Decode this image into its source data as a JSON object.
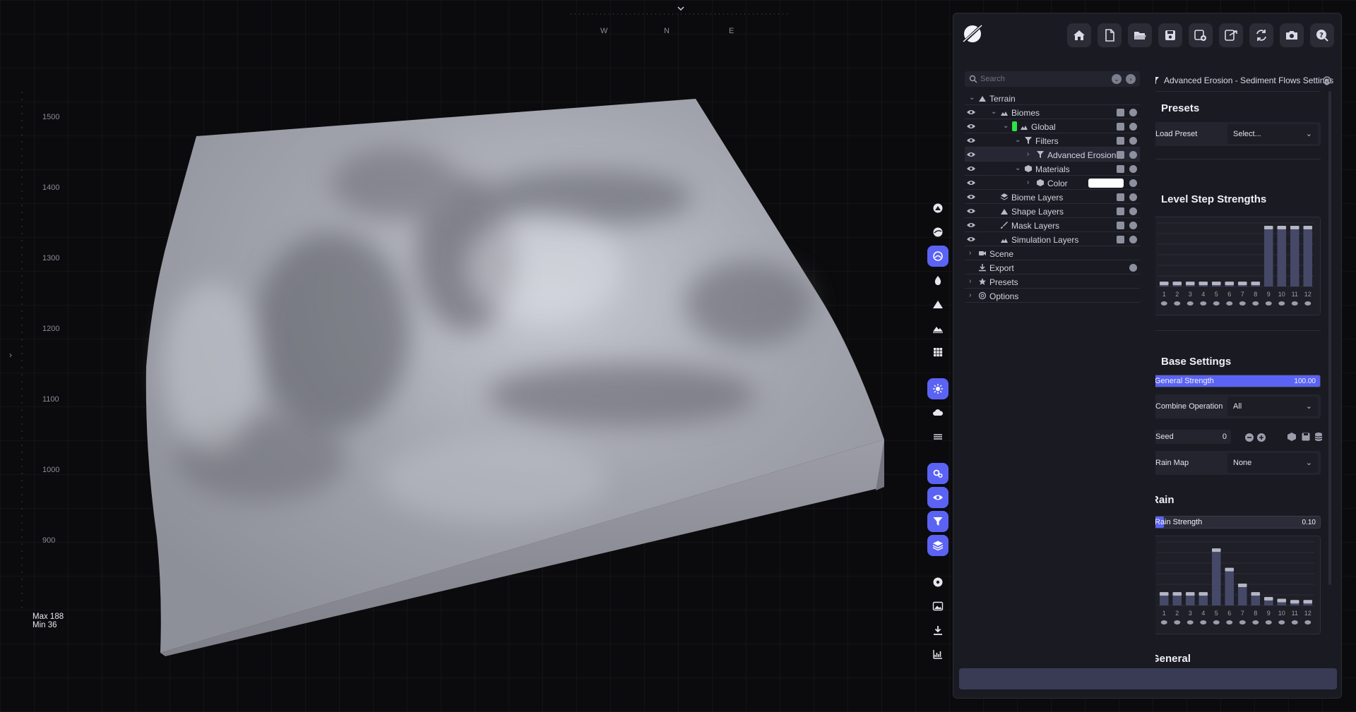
{
  "viewport": {
    "compass": {
      "west": "W",
      "north": "N",
      "east": "E"
    },
    "ruler_labels": [
      "1500",
      "1400",
      "1300",
      "1200",
      "1100",
      "1000",
      "900"
    ],
    "stats": {
      "max": "Max 188",
      "min": "Min 36"
    },
    "colors": {
      "background": "#0b0b0d",
      "grid": "#1e1f24",
      "terrain_top": "#a8aab4",
      "terrain_side": "#8f9099"
    }
  },
  "toolbar": {
    "buttons": [
      {
        "name": "terrain-view-icon",
        "active": false
      },
      {
        "name": "globe-icon",
        "active": false
      },
      {
        "name": "biome-icon",
        "active": true
      },
      {
        "name": "water-drop-icon",
        "active": false
      },
      {
        "name": "mountain-icon",
        "active": false
      },
      {
        "name": "landscape-icon",
        "active": false
      },
      {
        "name": "grid-icon",
        "active": false
      },
      {
        "name": "sun-icon",
        "active": true
      },
      {
        "name": "cloud-icon",
        "active": false
      },
      {
        "name": "fog-icon",
        "active": false
      },
      {
        "name": "settings-gears-icon",
        "active": true
      },
      {
        "name": "eye-icon",
        "active": true
      },
      {
        "name": "filter-icon",
        "active": true
      },
      {
        "name": "layers-icon",
        "active": true
      },
      {
        "name": "target-icon",
        "active": false
      },
      {
        "name": "image-icon",
        "active": false
      },
      {
        "name": "download-icon",
        "active": false
      },
      {
        "name": "chart-icon",
        "active": false
      }
    ]
  },
  "header": {
    "buttons": [
      "home-icon",
      "new-file-icon",
      "open-folder-icon",
      "save-icon",
      "save-as-icon",
      "export-icon",
      "refresh-icon",
      "camera-icon",
      "help-icon"
    ]
  },
  "tree": {
    "search_placeholder": "Search",
    "items": [
      {
        "label": "Terrain",
        "eye": false,
        "indent": 0,
        "icon": "terrain-icon",
        "chev": "open"
      },
      {
        "label": "Biomes",
        "eye": true,
        "indent": 1,
        "icon": "biome-icon",
        "chev": "open",
        "actions": true
      },
      {
        "label": "Global",
        "eye": true,
        "indent": 2,
        "icon": "biome-icon",
        "chev": "open",
        "actions": true,
        "green": true
      },
      {
        "label": "Filters",
        "eye": true,
        "indent": 3,
        "icon": "filter-icon",
        "chev": "open",
        "actions": true
      },
      {
        "label": "Advanced Erosion - Se",
        "eye": true,
        "indent": 4,
        "icon": "filter-icon",
        "chev": "closed",
        "actions": true,
        "selected": true
      },
      {
        "label": "Materials",
        "eye": true,
        "indent": 3,
        "icon": "material-icon",
        "chev": "open",
        "actions": true
      },
      {
        "label": "Color",
        "eye": true,
        "indent": 4,
        "icon": "material-icon",
        "chev": "closed",
        "actions": true,
        "swatch": "#ffffff"
      },
      {
        "label": "Biome Layers",
        "eye": true,
        "indent": 1,
        "icon": "layers-icon",
        "chev": "none",
        "actions": true
      },
      {
        "label": "Shape Layers",
        "eye": true,
        "indent": 1,
        "icon": "mountain-icon",
        "chev": "none",
        "actions": true
      },
      {
        "label": "Mask Layers",
        "eye": true,
        "indent": 1,
        "icon": "brush-icon",
        "chev": "none",
        "actions": true
      },
      {
        "label": "Simulation Layers",
        "eye": true,
        "indent": 1,
        "icon": "biome-icon",
        "chev": "none",
        "actions": true
      },
      {
        "label": "Scene",
        "eye": false,
        "indent": 0,
        "icon": "camera-icon",
        "chev": "closed"
      },
      {
        "label": "Export",
        "eye": false,
        "indent": 0,
        "icon": "download-icon",
        "chev": "none",
        "add": true
      },
      {
        "label": "Presets",
        "eye": false,
        "indent": 0,
        "icon": "star-icon",
        "chev": "closed"
      },
      {
        "label": "Options",
        "eye": false,
        "indent": 0,
        "icon": "gear-icon",
        "chev": "closed"
      }
    ]
  },
  "settings": {
    "title": "Advanced Erosion - Sediment Flows Settings",
    "presets": {
      "heading": "Presets",
      "load_label": "Load Preset",
      "load_value": "Select..."
    },
    "level_step": {
      "heading": "Level Step Strengths",
      "values": [
        0.08,
        0.08,
        0.08,
        0.08,
        0.08,
        0.08,
        0.08,
        0.08,
        1.0,
        1.0,
        1.0,
        1.0
      ],
      "labels": [
        "1",
        "2",
        "3",
        "4",
        "5",
        "6",
        "7",
        "8",
        "9",
        "10",
        "11",
        "12"
      ]
    },
    "base": {
      "heading": "Base Settings",
      "general_strength_label": "General Strength",
      "general_strength_value": "100.00",
      "general_strength_fill": 1.0,
      "combine_label": "Combine Operation",
      "combine_value": "All",
      "seed_label": "Seed",
      "seed_value": "0",
      "rain_map_label": "Rain Map",
      "rain_map_value": "None"
    },
    "rain": {
      "heading": "Rain",
      "strength_label": "Rain Strength",
      "strength_value": "0.10",
      "strength_fill": 0.07,
      "values": [
        0.22,
        0.22,
        0.22,
        0.22,
        0.94,
        0.62,
        0.36,
        0.22,
        0.14,
        0.11,
        0.09,
        0.09
      ],
      "labels": [
        "1",
        "2",
        "3",
        "4",
        "5",
        "6",
        "7",
        "8",
        "9",
        "10",
        "11",
        "12"
      ]
    },
    "next_heading": "General"
  }
}
